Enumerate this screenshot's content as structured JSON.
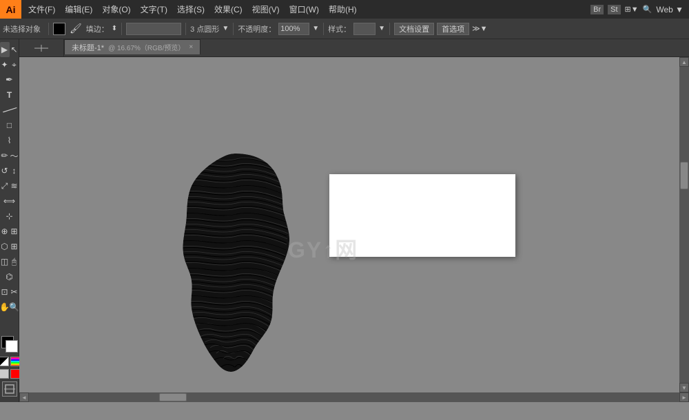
{
  "app": {
    "logo": "Ai",
    "web_label": "Web ▼"
  },
  "menubar": {
    "items": [
      "文件(F)",
      "编辑(E)",
      "对象(O)",
      "文字(T)",
      "选择(S)",
      "效果(C)",
      "视图(V)",
      "窗口(W)",
      "帮助(H)"
    ]
  },
  "bridge_icons": [
    "Br",
    "St",
    "⊞ ▼",
    "⚙"
  ],
  "toolbar": {
    "selection": "未选择对象",
    "fill_label": "填边：",
    "stroke_label": "",
    "size_label": "3 点圆形",
    "opacity_label": "不透明度：",
    "opacity_value": "100%",
    "style_label": "样式：",
    "doc_settings": "文档设置",
    "preferences": "首选项"
  },
  "tab": {
    "title": "未标题-1*",
    "info": "@ 16.67%（RGB/预览）",
    "close": "×"
  },
  "left_toolbar": {
    "tools": [
      {
        "name": "selection-tool",
        "icon": "▶",
        "label": "选择工具"
      },
      {
        "name": "direct-selection-tool",
        "icon": "↖",
        "label": "直接选择"
      },
      {
        "name": "magic-wand-tool",
        "icon": "✦",
        "label": "魔棒"
      },
      {
        "name": "lasso-tool",
        "icon": "⌖",
        "label": "套索"
      },
      {
        "name": "pen-tool",
        "icon": "✒",
        "label": "钢笔"
      },
      {
        "name": "type-tool",
        "icon": "T",
        "label": "文字"
      },
      {
        "name": "line-tool",
        "icon": "╲",
        "label": "直线"
      },
      {
        "name": "rectangle-tool",
        "icon": "□",
        "label": "矩形"
      },
      {
        "name": "brush-tool",
        "icon": "⌇",
        "label": "画笔"
      },
      {
        "name": "pencil-tool",
        "icon": "✏",
        "label": "铅笔"
      },
      {
        "name": "rotate-tool",
        "icon": "↺",
        "label": "旋转"
      },
      {
        "name": "reflect-tool",
        "icon": "↕",
        "label": "镜像"
      },
      {
        "name": "scale-tool",
        "icon": "⤢",
        "label": "比例"
      },
      {
        "name": "warp-tool",
        "icon": "≈",
        "label": "变形"
      },
      {
        "name": "width-tool",
        "icon": "⟺",
        "label": "宽度"
      },
      {
        "name": "free-transform-tool",
        "icon": "⊹",
        "label": "自由变换"
      },
      {
        "name": "shape-builder-tool",
        "icon": "⊕",
        "label": "形状生成器"
      },
      {
        "name": "perspective-tool",
        "icon": "⬡",
        "label": "透视"
      },
      {
        "name": "mesh-tool",
        "icon": "⊞",
        "label": "网格"
      },
      {
        "name": "gradient-tool",
        "icon": "◫",
        "label": "渐变"
      },
      {
        "name": "eyedropper-tool",
        "icon": "🖫",
        "label": "吸管"
      },
      {
        "name": "blend-tool",
        "icon": "⌬",
        "label": "混合"
      },
      {
        "name": "live-paint-tool",
        "icon": "⬛",
        "label": "实时上色"
      },
      {
        "name": "artboard-tool",
        "icon": "⊡",
        "label": "画板"
      },
      {
        "name": "slice-tool",
        "icon": "✂",
        "label": "切片"
      },
      {
        "name": "hand-tool",
        "icon": "✋",
        "label": "手形"
      },
      {
        "name": "zoom-tool",
        "icon": "⊕",
        "label": "缩放"
      }
    ],
    "fg_color": "#000000",
    "bg_color": "#ffffff"
  },
  "canvas": {
    "bg_color": "#888888",
    "page_bg": "#ffffff",
    "watermark": "GY↑网"
  },
  "status_bar": {
    "zoom": "16.67%",
    "mode": "RGB/预览"
  }
}
